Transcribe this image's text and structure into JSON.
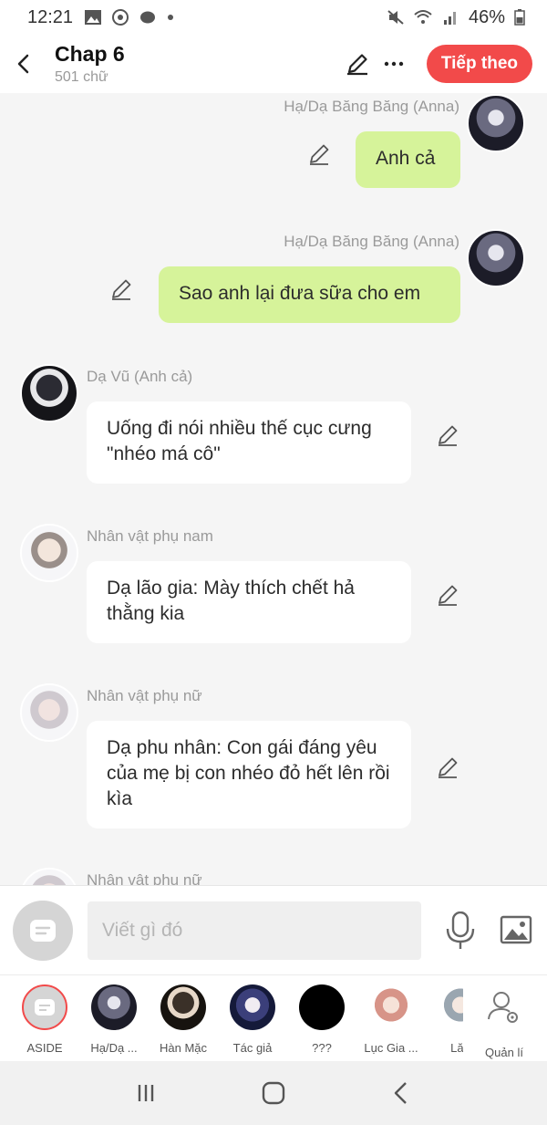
{
  "status": {
    "time": "12:21",
    "battery": "46%"
  },
  "header": {
    "title": "Chap 6",
    "subtitle": "501 chữ",
    "next_label": "Tiếp theo"
  },
  "messages": [
    {
      "side": "out",
      "name": "Hạ/Dạ Băng Băng (Anna)",
      "text": "Anh cả"
    },
    {
      "side": "out",
      "name": "Hạ/Dạ Băng Băng (Anna)",
      "text": "Sao anh lại đưa sữa cho em"
    },
    {
      "side": "in",
      "name": "Dạ Vũ (Anh cả)",
      "text": "Uống đi nói nhiều thế cục cưng \"nhéo má cô\""
    },
    {
      "side": "in",
      "name": "Nhân vật phụ nam",
      "text": "Dạ lão gia: Mày thích chết hả thằng kia"
    },
    {
      "side": "in",
      "name": "Nhân vật phụ nữ",
      "text": "Dạ phu nhân: Con gái đáng yêu của mẹ bị con nhéo đỏ hết lên rồi kìa"
    },
    {
      "side": "in",
      "name": "Nhân vật phụ nữ",
      "text": ""
    }
  ],
  "composer": {
    "placeholder": "Viết gì đó"
  },
  "characters": [
    {
      "label": "ASIDE"
    },
    {
      "label": "Hạ/Dạ ..."
    },
    {
      "label": "Hàn Mặc"
    },
    {
      "label": "Tác giả"
    },
    {
      "label": "???"
    },
    {
      "label": "Lục Gia ..."
    },
    {
      "label": "Lăn"
    }
  ],
  "manage": {
    "label": "Quản lí"
  },
  "colors": {
    "accent": "#f24a4a",
    "bubble_out": "#d6f39a",
    "bubble_in": "#ffffff"
  }
}
